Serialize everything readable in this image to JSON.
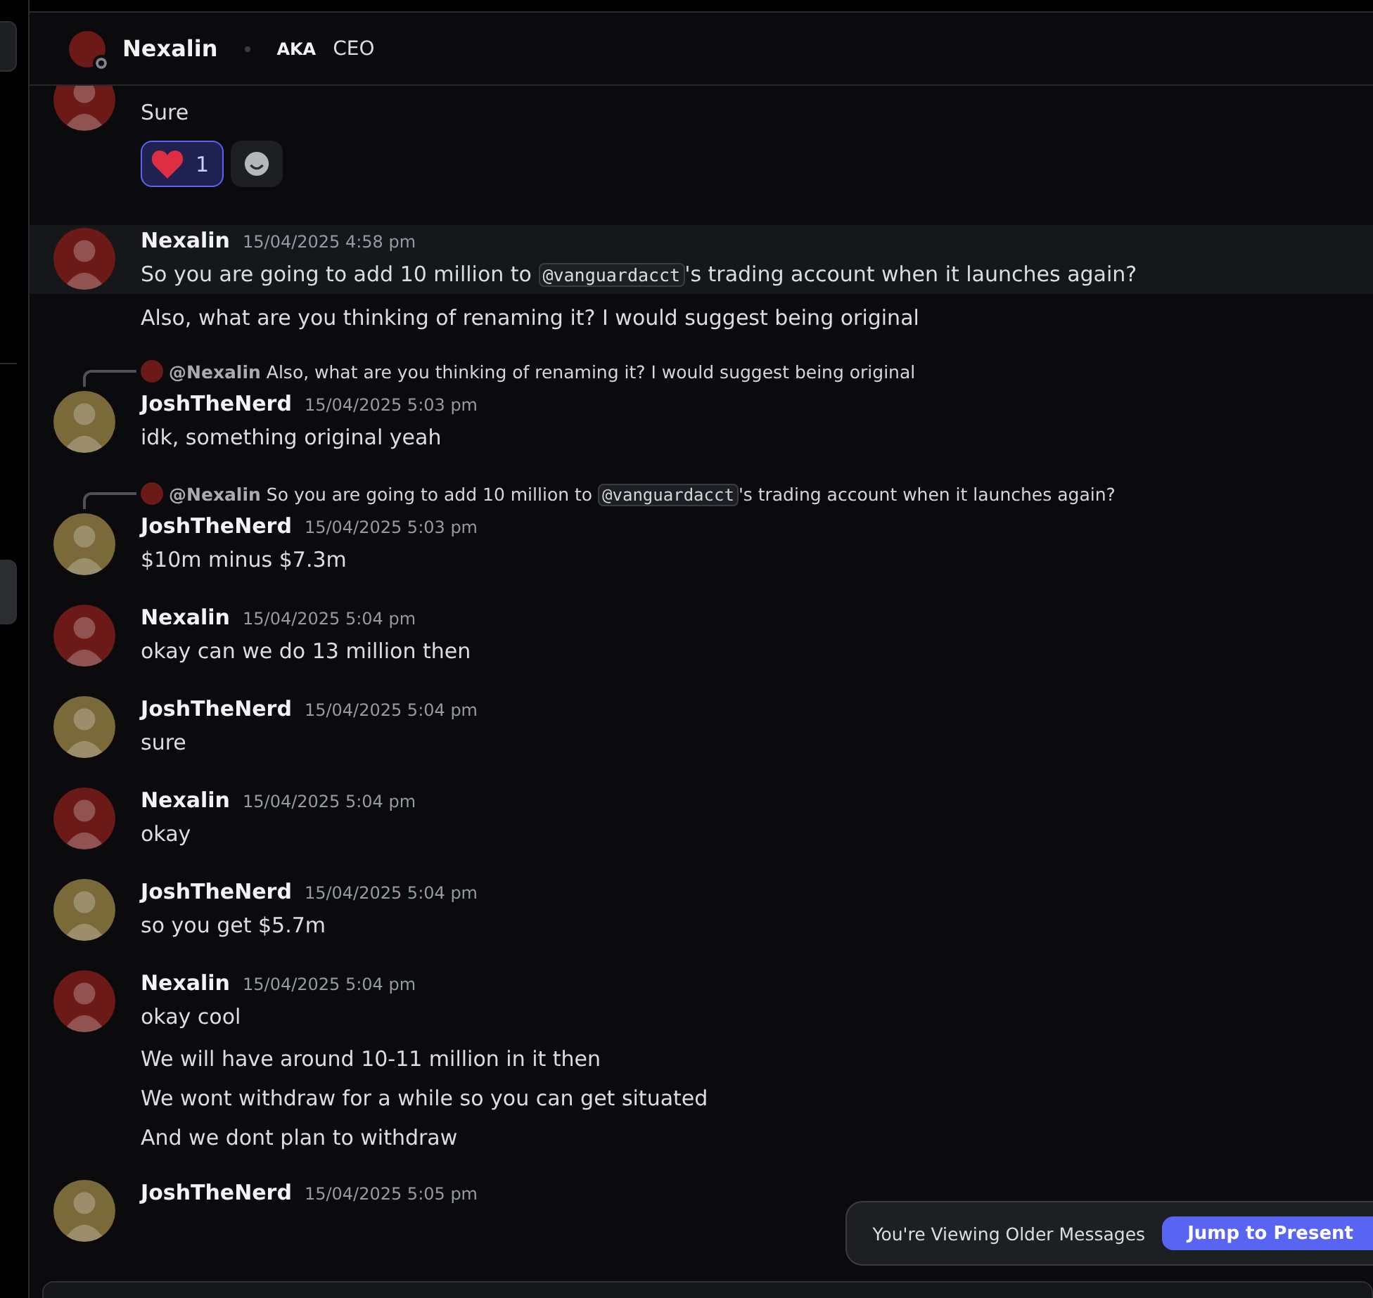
{
  "header": {
    "name": "Nexalin",
    "online": false,
    "tag": "AKA",
    "subtitle": "CEO"
  },
  "messages": [
    {
      "color": "#6b1a17",
      "highlighted": false,
      "lines": [
        [
          {
            "kind": "text",
            "text": "Sure"
          }
        ]
      ],
      "reactions": [
        {
          "kind": "heart",
          "count": "1",
          "selected": true
        }
      ]
    },
    {
      "author": "Nexalin",
      "time": "15/04/2025 4:58 pm",
      "color": "#6b1a17",
      "highlighted": true,
      "lines": [
        [
          {
            "kind": "text",
            "text": "So you are going to add 10 million to "
          },
          {
            "kind": "mention",
            "text": "@vanguardacct"
          },
          {
            "kind": "text",
            "text": "'s trading account when it launches again?"
          }
        ],
        [
          {
            "kind": "text",
            "text": "Also, what are you thinking of renaming it? I would suggest being original"
          }
        ]
      ]
    },
    {
      "author": "JoshTheNerd",
      "time": "15/04/2025 5:03 pm",
      "color": "#7a6a3a",
      "highlighted": false,
      "reply": {
        "author": "@Nexalin",
        "color": "#6b1a17",
        "parts": [
          {
            "kind": "text",
            "text": "Also, what are you thinking of renaming it? I would suggest being original"
          }
        ]
      },
      "lines": [
        [
          {
            "kind": "text",
            "text": "idk, something original yeah"
          }
        ]
      ]
    },
    {
      "author": "JoshTheNerd",
      "time": "15/04/2025 5:03 pm",
      "color": "#7a6a3a",
      "highlighted": false,
      "reply": {
        "author": "@Nexalin",
        "color": "#6b1a17",
        "parts": [
          {
            "kind": "text",
            "text": "So you are going to add 10 million to "
          },
          {
            "kind": "mention",
            "text": "@vanguardacct"
          },
          {
            "kind": "text",
            "text": "'s trading account when it launches again?"
          }
        ]
      },
      "lines": [
        [
          {
            "kind": "text",
            "text": "$10m minus $7.3m"
          }
        ]
      ]
    },
    {
      "author": "Nexalin",
      "time": "15/04/2025 5:04 pm",
      "color": "#6b1a17",
      "highlighted": false,
      "lines": [
        [
          {
            "kind": "text",
            "text": "okay can we do 13 million then"
          }
        ]
      ]
    },
    {
      "author": "JoshTheNerd",
      "time": "15/04/2025 5:04 pm",
      "color": "#7a6a3a",
      "highlighted": false,
      "lines": [
        [
          {
            "kind": "text",
            "text": "sure"
          }
        ]
      ]
    },
    {
      "author": "Nexalin",
      "time": "15/04/2025 5:04 pm",
      "color": "#6b1a17",
      "highlighted": false,
      "lines": [
        [
          {
            "kind": "text",
            "text": "okay"
          }
        ]
      ]
    },
    {
      "author": "JoshTheNerd",
      "time": "15/04/2025 5:04 pm",
      "color": "#7a6a3a",
      "highlighted": false,
      "lines": [
        [
          {
            "kind": "text",
            "text": "so you get $5.7m"
          }
        ]
      ]
    },
    {
      "author": "Nexalin",
      "time": "15/04/2025 5:04 pm",
      "color": "#6b1a17",
      "highlighted": false,
      "lines": [
        [
          {
            "kind": "text",
            "text": "okay cool"
          }
        ],
        [
          {
            "kind": "text",
            "text": "We will have around 10-11 million in it then"
          }
        ],
        [
          {
            "kind": "text",
            "text": "We wont withdraw for a while so you can get situated"
          }
        ],
        [
          {
            "kind": "text",
            "text": "And we dont plan to withdraw"
          }
        ]
      ]
    },
    {
      "author": "JoshTheNerd",
      "time": "15/04/2025 5:05 pm",
      "color": "#7a6a3a",
      "highlighted": false
    }
  ],
  "jump_bar": {
    "notice": "You're Viewing Older Messages",
    "button": "Jump to Present"
  }
}
